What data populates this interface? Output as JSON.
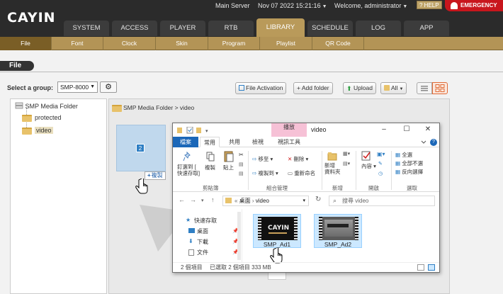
{
  "header": {
    "logo": "CAYIN",
    "server": "Main Server",
    "datetime": "Nov 07 2022 15:21:16",
    "welcome": "Welcome, administrator",
    "help": "HELP",
    "emergency": "EMERGENCY"
  },
  "main_tabs": [
    "SYSTEM",
    "ACCESS",
    "PLAYER",
    "RTB",
    "LIBRARY",
    "SCHEDULE",
    "LOG",
    "APP"
  ],
  "active_main_tab": "LIBRARY",
  "sub_nav": [
    "File",
    "Font",
    "Clock",
    "Skin",
    "Program",
    "Playlist",
    "QR Code"
  ],
  "active_sub_nav": "File",
  "page": {
    "title": "File",
    "group_label": "Select a group:",
    "group_value": "SMP-8000",
    "file_activation": "File Activation",
    "add_folder": "+ Add folder",
    "upload": "Upload",
    "filter_all": "All"
  },
  "tree": {
    "root": "SMP Media Folder",
    "children": [
      "protected",
      "video"
    ],
    "selected": "video"
  },
  "breadcrumb": "SMP Media Folder > video",
  "drag": {
    "count": "2",
    "copy_label": "複製"
  },
  "explorer": {
    "title": "video",
    "context_tab": "播放",
    "tabs": [
      "檔案",
      "常用",
      "共用",
      "檢視",
      "視訊工具"
    ],
    "ribbon": {
      "pin": "釘選到 [\n快速存取]",
      "copy": "複製",
      "paste": "貼上",
      "move_to": "移至",
      "copy_to": "複製到",
      "delete": "刪除",
      "rename": "重新命名",
      "new_folder": "新增\n資料夾",
      "properties": "內容",
      "select_all": "全選",
      "select_none": "全部不選",
      "invert": "反向選擇",
      "groups": [
        "剪貼簿",
        "組合管理",
        "新增",
        "開啟",
        "選取"
      ]
    },
    "address": [
      "桌面",
      "video"
    ],
    "search_placeholder": "搜尋 video",
    "nav": [
      "快速存取",
      "桌面",
      "下載",
      "文件"
    ],
    "files": [
      "SMP_Ad1",
      "SMP_Ad2"
    ],
    "status_count": "2 個項目",
    "status_selected": "已選取 2 個項目  333 MB"
  },
  "colors": {
    "brand_gold": "#b99a5a",
    "emergency_red": "#c8161d",
    "explorer_blue": "#1b67b8"
  }
}
